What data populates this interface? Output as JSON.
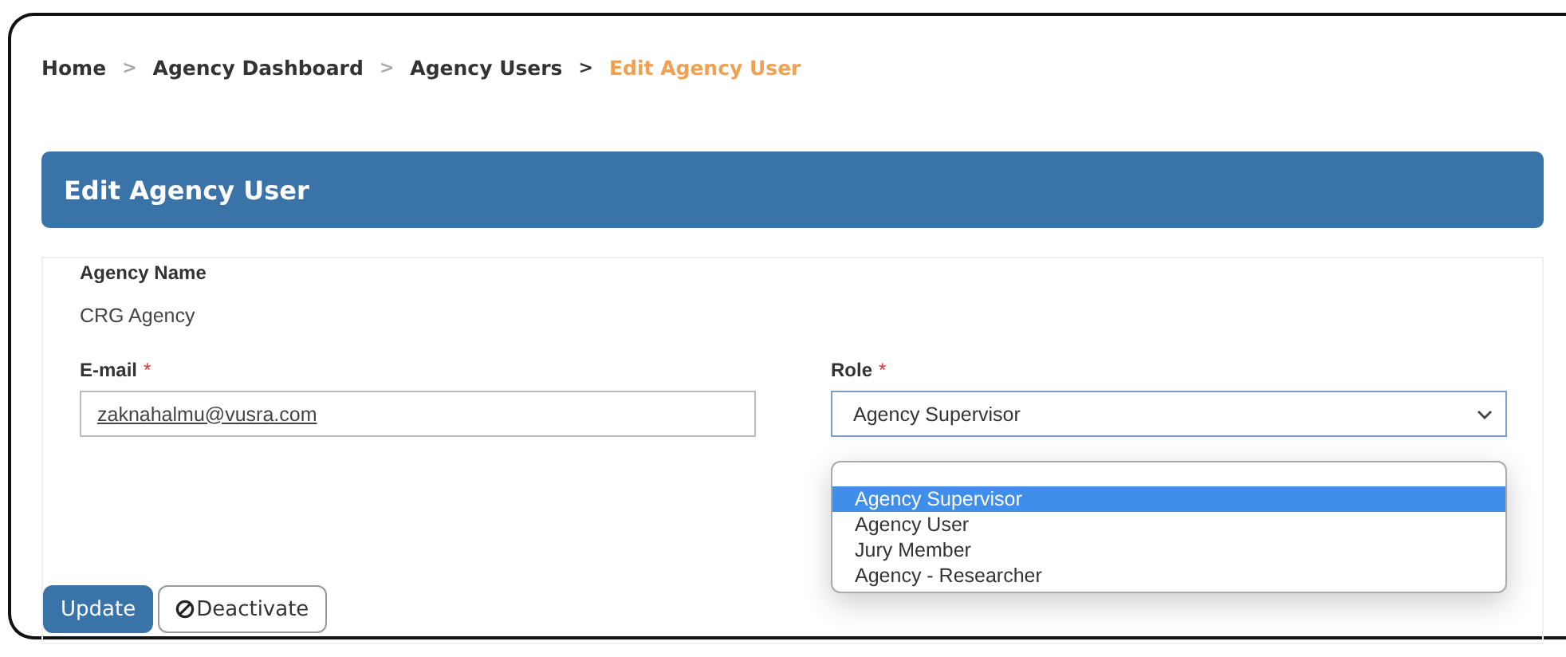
{
  "breadcrumb": [
    {
      "label": "Home",
      "current": false
    },
    {
      "label": "Agency Dashboard",
      "current": false
    },
    {
      "label": "Agency Users",
      "current": false
    },
    {
      "label": "Edit Agency User",
      "current": true
    }
  ],
  "breadcrumb_separator": ">",
  "header": {
    "title": "Edit Agency User"
  },
  "agency": {
    "label": "Agency Name",
    "value": "CRG Agency"
  },
  "email": {
    "label": "E-mail",
    "required": true,
    "value": "zaknahalmu@vusra.com"
  },
  "role": {
    "label": "Role",
    "required": true,
    "value": "Agency Supervisor",
    "expanded": true,
    "options": [
      {
        "label": "Agency Supervisor",
        "selected": true
      },
      {
        "label": "Agency User",
        "selected": false
      },
      {
        "label": "Jury Member",
        "selected": false
      },
      {
        "label": "Agency - Researcher",
        "selected": false
      }
    ]
  },
  "required_mark": "*",
  "buttons": [
    {
      "kind": "primary",
      "label": "Update"
    },
    {
      "kind": "deactivate",
      "label": "Deactivate"
    }
  ]
}
